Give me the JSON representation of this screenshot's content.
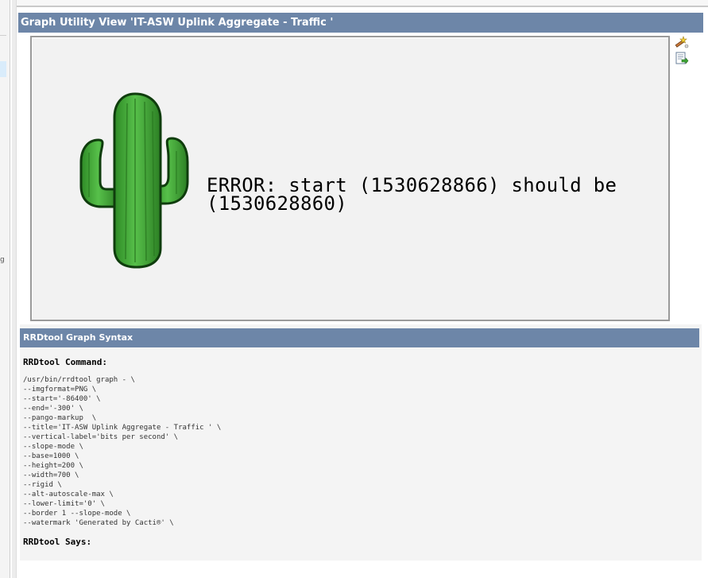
{
  "window": {
    "top_strip_text": "— · ·"
  },
  "sidebar": {
    "glyph": "g"
  },
  "graph_view": {
    "title": "Graph Utility View 'IT-ASW Uplink Aggregate - Traffic '",
    "error_message": "ERROR: start (1530628866) should be\n(1530628860)",
    "tools": [
      {
        "icon": "zoom-wand-icon"
      },
      {
        "icon": "export-csv-icon"
      }
    ]
  },
  "rrdtool": {
    "section_title": "RRDtool Graph Syntax",
    "command_label": "RRDtool Command:",
    "command_lines": [
      "/usr/bin/rrdtool graph - \\",
      "--imgformat=PNG \\",
      "--start='-86400' \\",
      "--end='-300' \\",
      "--pango-markup  \\",
      "--title='IT-ASW Uplink Aggregate - Traffic ' \\",
      "--vertical-label='bits per second' \\",
      "--slope-mode \\",
      "--base=1000 \\",
      "--height=200 \\",
      "--width=700 \\",
      "--rigid \\",
      "--alt-autoscale-max \\",
      "--lower-limit='0' \\",
      "--border 1 --slope-mode \\",
      "--watermark 'Generated by Cacti®' \\"
    ],
    "says_label": "RRDtool Says:"
  },
  "colors": {
    "header_bar": "#6d86a8",
    "panel_bg": "#f4f4f4",
    "cactus_green": "#3fa535"
  }
}
